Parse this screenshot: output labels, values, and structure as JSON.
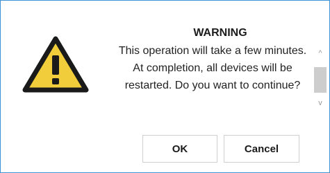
{
  "dialog": {
    "title": "WARNING",
    "message": "This operation will take a few minutes. At completion, all devices will be restarted. Do you want to continue?",
    "icon": "warning-triangle-icon",
    "accent_color": "#3c93d6",
    "icon_fill": "#f1cd3b"
  },
  "buttons": {
    "ok_label": "OK",
    "cancel_label": "Cancel"
  },
  "scrollbar": {
    "up_glyph": "^",
    "down_glyph": "v"
  }
}
